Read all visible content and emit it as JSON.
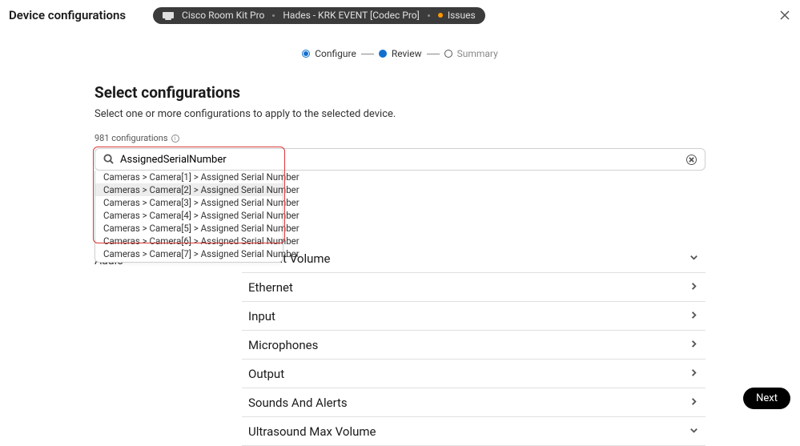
{
  "header": {
    "title": "Device configurations",
    "device_model": "Cisco Room Kit Pro",
    "device_name": "Hades - KRK EVENT [Codec Pro]",
    "status": "Issues"
  },
  "steps": {
    "configure": "Configure",
    "review": "Review",
    "summary": "Summary"
  },
  "main": {
    "title": "Select configurations",
    "subtitle": "Select one or more configurations to apply to the selected device.",
    "count": "981 configurations"
  },
  "search": {
    "value": "AssignedSerialNumber"
  },
  "suggestions": [
    "Cameras > Camera[1] > Assigned Serial Number",
    "Cameras > Camera[2] > Assigned Serial Number",
    "Cameras > Camera[3] > Assigned Serial Number",
    "Cameras > Camera[4] > Assigned Serial Number",
    "Cameras > Camera[5] > Assigned Serial Number",
    "Cameras > Camera[6] > Assigned Serial Number",
    "Cameras > Camera[7] > Assigned Serial Number"
  ],
  "sidebar": {
    "items": [
      "Audio"
    ]
  },
  "accordion": {
    "items": [
      {
        "label": "Default Volume",
        "icon": "down"
      },
      {
        "label": "Ethernet",
        "icon": "right"
      },
      {
        "label": "Input",
        "icon": "right"
      },
      {
        "label": "Microphones",
        "icon": "right"
      },
      {
        "label": "Output",
        "icon": "right"
      },
      {
        "label": "Sounds And Alerts",
        "icon": "right"
      },
      {
        "label": "Ultrasound Max Volume",
        "icon": "down"
      }
    ]
  },
  "next_label": "Next"
}
